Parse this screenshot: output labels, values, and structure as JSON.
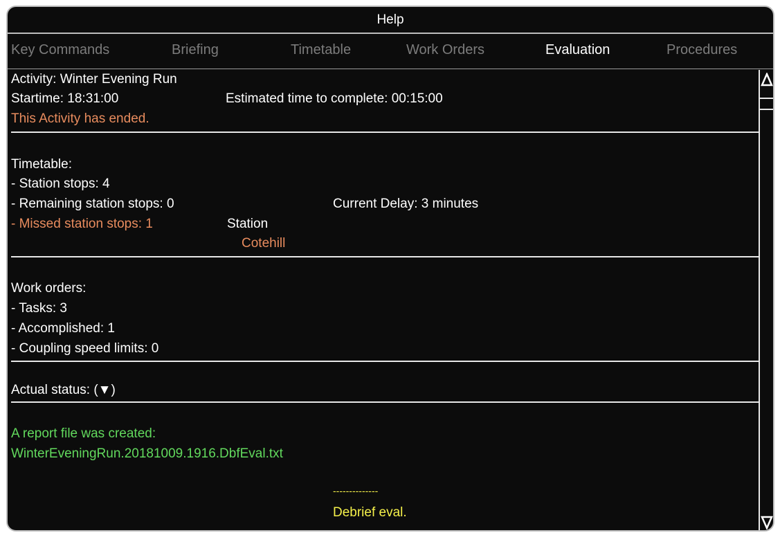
{
  "window": {
    "title": "Help"
  },
  "tabs": [
    {
      "label": "Key Commands"
    },
    {
      "label": "Briefing"
    },
    {
      "label": "Timetable"
    },
    {
      "label": "Work Orders"
    },
    {
      "label": "Evaluation"
    },
    {
      "label": "Procedures"
    }
  ],
  "active_tab": "Evaluation",
  "activity": {
    "name_line": "Activity: Winter Evening Run",
    "start_line": "Startime: 18:31:00",
    "estimate_line": "Estimated time to complete: 00:15:00",
    "ended_line": "This Activity has ended."
  },
  "timetable": {
    "heading": "Timetable:",
    "station_stops": "- Station stops: 4",
    "remaining_stops": "- Remaining station stops: 0",
    "current_delay": "Current Delay: 3 minutes",
    "missed_stops": "- Missed station stops: 1",
    "station_header": "Station",
    "missed_station_name": "Cotehill"
  },
  "work_orders": {
    "heading": "Work orders:",
    "tasks": "- Tasks: 3",
    "accomplished": "- Accomplished: 1",
    "coupling_limits": "- Coupling speed limits: 0"
  },
  "status": {
    "label": "Actual status: (▼)"
  },
  "report": {
    "created_label": "A report file was created:",
    "filename": "WinterEveningRun.20181009.1916.DbfEval.txt"
  },
  "debrief": {
    "dashes": "--------------",
    "label": "Debrief eval."
  },
  "colors": {
    "alert": "#e88c5e",
    "success": "#62d95d",
    "highlight": "#f5f14a",
    "inactive_tab": "#7c7c7c"
  },
  "icons": {
    "scroll_up": "triangle-up",
    "scroll_down": "triangle-down"
  }
}
